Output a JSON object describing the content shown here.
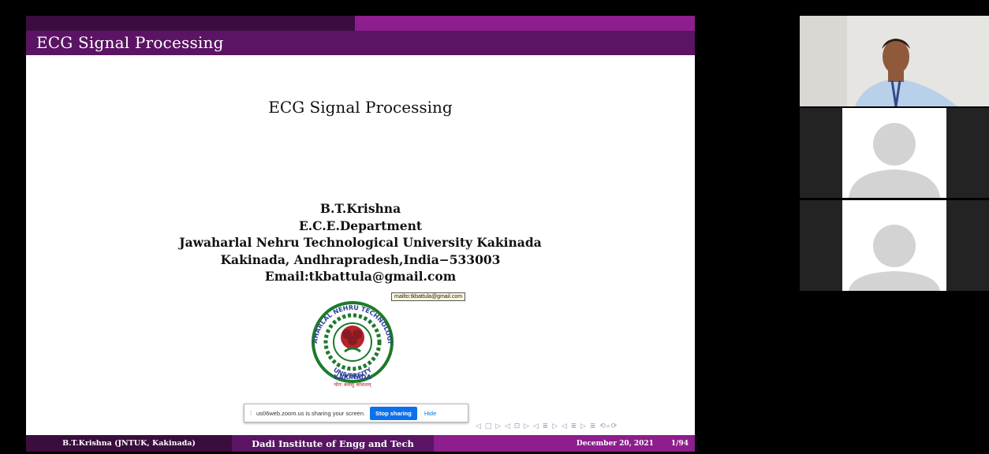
{
  "slide": {
    "header_title": "ECG Signal Processing",
    "title": "ECG Signal Processing",
    "author": "B.T.Krishna",
    "department": "E.C.E.Department",
    "university": "Jawaharlal Nehru Technological University Kakinada",
    "address": "Kakinada, Andhrapradesh,India−533003",
    "email": "Email:tkbattula@gmail.com",
    "tooltip": "mailto:tkbattula@gmail.com",
    "logo": {
      "top_text": "JAWAHARLAL NEHRU TECHNOLOGICAL",
      "bottom_text": "UNIVERSITY",
      "city": "KAKINADA",
      "motto": "योगः कर्मसु कौशलम्"
    },
    "nav_symbols": "◁ □ ▷ ◁ ⊡ ▷ ◁ ≣ ▷ ◁ ≣ ▷  ≣  ⟲⌕⟳",
    "footer": {
      "left": "B.T.Krishna  (JNTUK, Kakinada)",
      "center": "Dadi Institute of Engg and Tech",
      "date": "December 20, 2021",
      "page": "1/94"
    }
  },
  "share_bar": {
    "message": "us06web.zoom.us is sharing your screen.",
    "stop_label": "Stop sharing",
    "hide_label": "Hide"
  },
  "participants": [
    {
      "type": "video"
    },
    {
      "type": "avatar-icon"
    },
    {
      "type": "avatar-icon"
    }
  ],
  "colors": {
    "beamer_dark": "#3b0d3e",
    "beamer_mid": "#5b1463",
    "beamer_light": "#8e1d8d",
    "zoom_blue": "#0e71eb",
    "logo_green": "#1b7a2b",
    "logo_blue": "#2c3e9a",
    "logo_red": "#b5232b"
  }
}
